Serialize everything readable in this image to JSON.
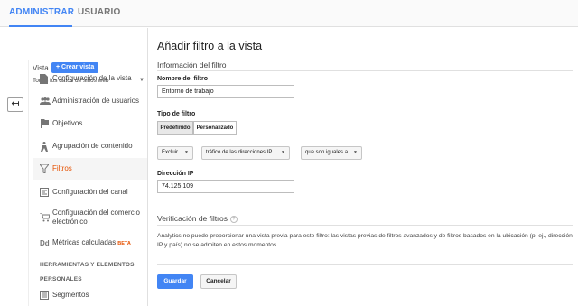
{
  "tabs": [
    {
      "label": "ADMINISTRAR",
      "active": true
    },
    {
      "label": "USUARIO",
      "active": false
    }
  ],
  "sidebar": {
    "vista_label": "Vista",
    "create_view_label": "+  Crear vista",
    "view_selected": "Todos los datos de sitios web",
    "items": [
      {
        "label": "Configuración de la vista",
        "icon": "document-icon"
      },
      {
        "label": "Administración de usuarios",
        "icon": "people-icon"
      },
      {
        "label": "Objetivos",
        "icon": "flag-icon"
      },
      {
        "label": "Agrupación de contenido",
        "icon": "person-walking-icon"
      },
      {
        "label": "Filtros",
        "icon": "filter-icon",
        "active": true
      },
      {
        "label": "Configuración del canal",
        "icon": "channel-icon"
      },
      {
        "label": "Configuración del comercio electrónico",
        "icon": "cart-icon"
      },
      {
        "label": "Métricas calculadas",
        "icon": "dd-icon",
        "badge": "BETA"
      }
    ],
    "section_tools": "HERRAMIENTAS Y ELEMENTOS",
    "section_personal": "PERSONALES",
    "segments_label": "Segmentos"
  },
  "main": {
    "title": "Añadir filtro a la vista",
    "filter_info_heading": "Información del filtro",
    "filter_name_label": "Nombre del filtro",
    "filter_name_value": "Entorno de trabajo",
    "filter_type_label": "Tipo de filtro",
    "filter_type_predefined": "Predefinido",
    "filter_type_custom": "Personalizado",
    "dropdown_exclude": "Excluir",
    "dropdown_source": "tráfico de las direcciones IP",
    "dropdown_condition": "que son iguales a",
    "ip_label": "Dirección IP",
    "ip_value": "74.125.109",
    "verification_heading": "Verificación de filtros",
    "verification_text": "Analytics no puede proporcionar una vista previa para este filtro: las vistas previas de filtros avanzados y de filtros basados en la ubicación (p. ej., dirección IP y país) no se admiten en estos momentos.",
    "save_label": "Guardar",
    "cancel_label": "Cancelar"
  },
  "colors": {
    "accent": "#4285f4",
    "active_item": "#e65100"
  }
}
